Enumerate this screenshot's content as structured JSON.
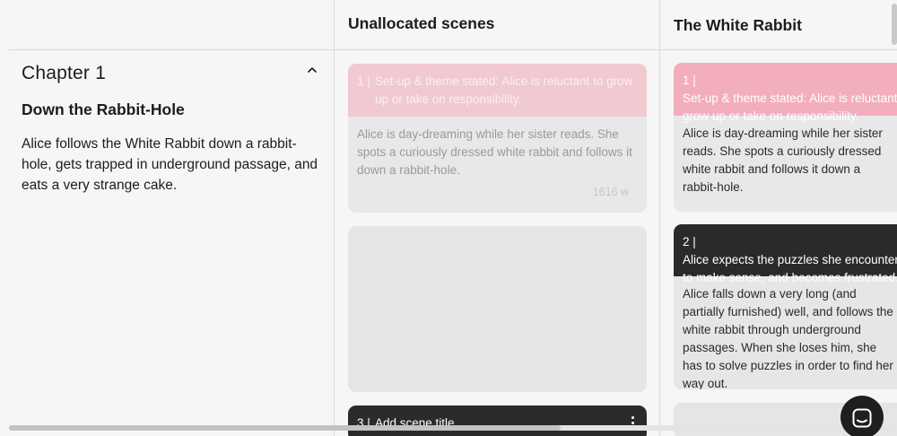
{
  "chapter": {
    "title": "Chapter 1",
    "subtitle": "Down the Rabbit-Hole",
    "description": "Alice follows the White Rabbit down a rabbit-hole, gets trapped in underground passage, and eats a very strange cake."
  },
  "columns": {
    "unallocated_title": "Unallocated scenes",
    "plotline_title": "The White Rabbit"
  },
  "unallocated": {
    "scene1": {
      "number": "1 |",
      "title": "Set-up & theme stated: Alice is reluctant to grow up or take on responsibility.",
      "summary": "Alice is day-dreaming while her sister reads. She spots a curiously dressed white rabbit and follows it down a rabbit-hole.",
      "word_count": "1616 w"
    },
    "scene3": {
      "number": "3 |",
      "title": "Add scene title..."
    }
  },
  "plotline": {
    "scene1": {
      "number": "1 |",
      "title": "Set-up & theme stated: Alice is reluctant to grow up or take on responsibility.",
      "summary": "Alice is day-dreaming while her sister reads. She spots a curiously dressed white rabbit and follows it down a rabbit-hole."
    },
    "scene2": {
      "number": "2 |",
      "title": "Alice expects the puzzles she encounters to make sense, and becomes frustrated.",
      "summary": "Alice falls down a very long (and partially furnished) well, and follows the white rabbit through underground passages. When she loses him, she has to solve puzzles in order to find her way out."
    }
  },
  "colors": {
    "pink_header": "#f2aebd",
    "faded_pink_header": "#f1c9d1",
    "dark_header": "#2a2a2a",
    "card_bg": "#e8e8e8",
    "page_bg": "#f6f6f6"
  },
  "icons": {
    "collapse": "chevron-up-icon",
    "menu": "more-vertical-icon",
    "chat": "chat-icon"
  }
}
